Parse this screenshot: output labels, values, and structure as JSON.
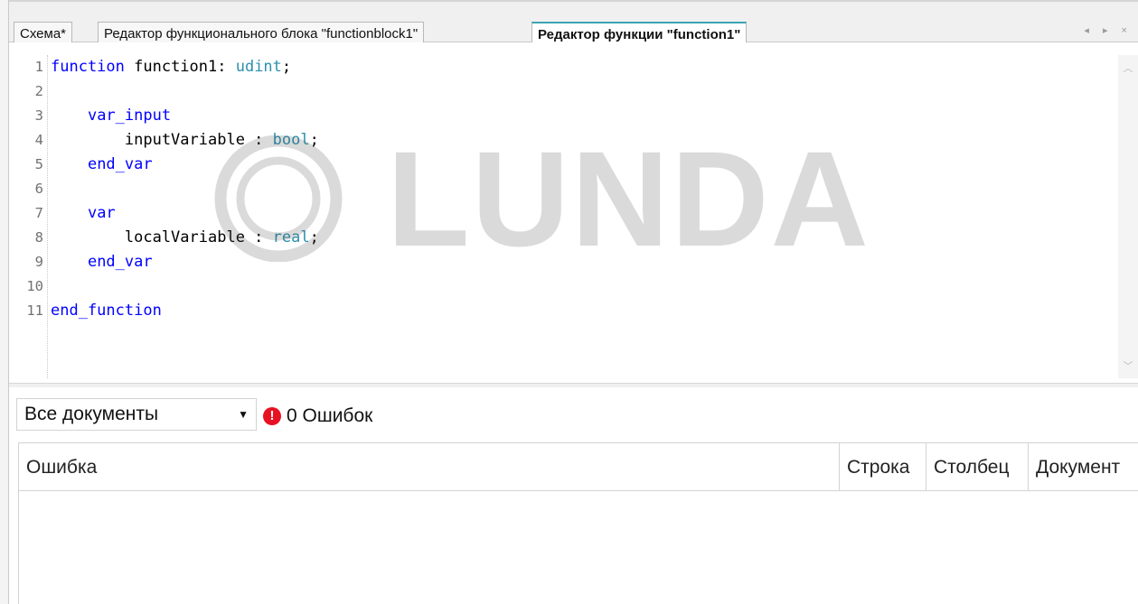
{
  "tabs": [
    {
      "label": "Схема*",
      "active": false
    },
    {
      "label": "Редактор функционального блока \"functionblock1\"",
      "active": false
    },
    {
      "label": "Редактор функции \"function1\"",
      "active": true
    }
  ],
  "tab_nav": "◂ ▸ ×",
  "editor": {
    "line_numbers": [
      "1",
      "2",
      "3",
      "4",
      "5",
      "6",
      "7",
      "8",
      "9",
      "10",
      "11"
    ],
    "lines": [
      [
        {
          "t": "function",
          "c": "kw"
        },
        {
          "t": " function1: ",
          "c": "id"
        },
        {
          "t": "udint",
          "c": "ty"
        },
        {
          "t": ";",
          "c": "id"
        }
      ],
      [],
      [
        {
          "t": "    ",
          "c": "id"
        },
        {
          "t": "var_input",
          "c": "kw"
        }
      ],
      [
        {
          "t": "        inputVariable : ",
          "c": "id"
        },
        {
          "t": "bool",
          "c": "ty"
        },
        {
          "t": ";",
          "c": "id"
        }
      ],
      [
        {
          "t": "    ",
          "c": "id"
        },
        {
          "t": "end_var",
          "c": "kw"
        }
      ],
      [],
      [
        {
          "t": "    ",
          "c": "id"
        },
        {
          "t": "var",
          "c": "kw"
        }
      ],
      [
        {
          "t": "        localVariable : ",
          "c": "id"
        },
        {
          "t": "real",
          "c": "ty"
        },
        {
          "t": ";",
          "c": "id"
        }
      ],
      [
        {
          "t": "    ",
          "c": "id"
        },
        {
          "t": "end_var",
          "c": "kw"
        }
      ],
      [],
      [
        {
          "t": "end_function",
          "c": "kw"
        }
      ]
    ]
  },
  "watermark": {
    "text": "LUNDA"
  },
  "errors": {
    "filter_value": "Все документы",
    "count_text": "0 Ошибок",
    "columns": [
      "Ошибка",
      "Строка",
      "Столбец",
      "Документ"
    ],
    "rows": []
  },
  "colors": {
    "keyword": "#0000ff",
    "type": "#2b91af",
    "error_badge": "#e81123",
    "active_tab_accent": "#3aa3b3"
  }
}
